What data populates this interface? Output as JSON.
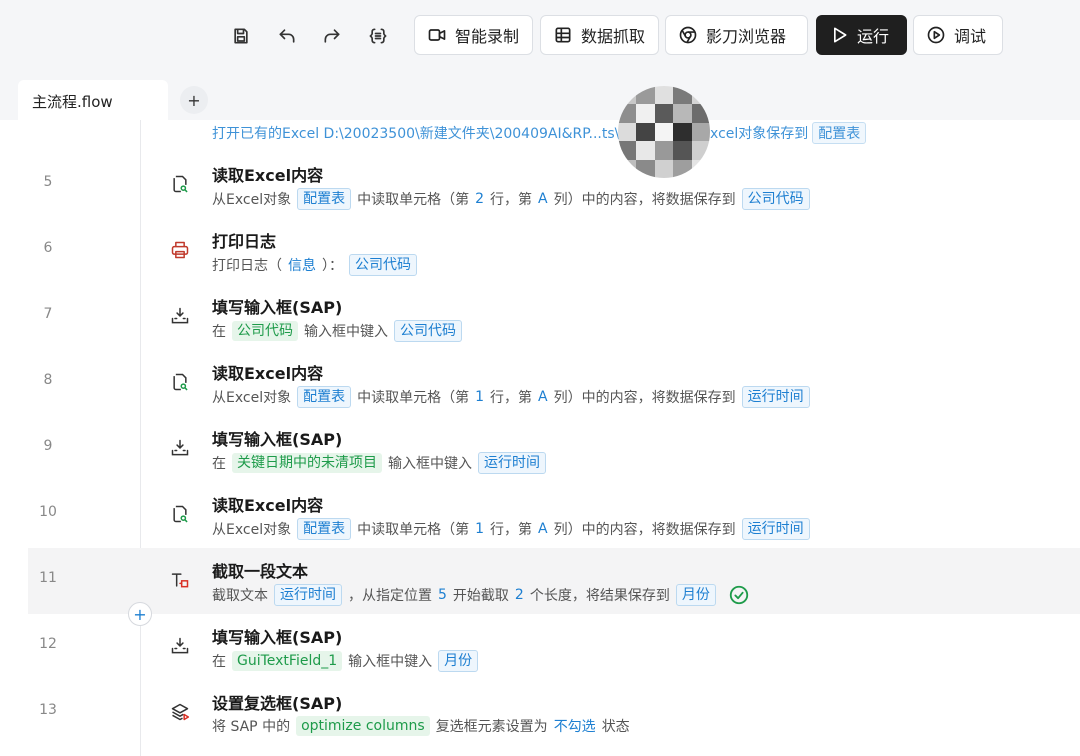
{
  "toolbar": {
    "icons": [
      "save-icon",
      "undo-icon",
      "redo-icon",
      "variables-icon"
    ],
    "buttons": {
      "record": "智能录制",
      "capture": "数据抓取",
      "browser": "影刀浏览器",
      "run": "运行",
      "debug": "调试"
    }
  },
  "tabs": {
    "main": "主流程.flow",
    "add": "+"
  },
  "partial_row": {
    "text": "打开已有的Excel  D:\\20023500\\新建文件夹\\200409AI&RP...ts\\2.BS ... ，将Excel对象保存到",
    "chip": "配置表"
  },
  "steps": [
    {
      "num": "5",
      "icon": "read-excel-icon",
      "title": "读取Excel内容",
      "desc": {
        "a": "从Excel对象",
        "b": "配置表",
        "c": "中读取单元格（第",
        "d": "2",
        "e": "行，第",
        "f": "A",
        "g": "列）中的内容，将数据保存到",
        "h": "公司代码"
      }
    },
    {
      "num": "6",
      "icon": "print-log-icon",
      "title": "打印日志",
      "desc": {
        "a": "打印日志（",
        "b": "信息",
        "c": "）：",
        "d": "公司代码"
      }
    },
    {
      "num": "7",
      "icon": "input-fill-icon",
      "title": "填写输入框(SAP)",
      "desc": {
        "a": "在",
        "b": "公司代码",
        "c": "输入框中键入",
        "d": "公司代码"
      }
    },
    {
      "num": "8",
      "icon": "read-excel-icon",
      "title": "读取Excel内容",
      "desc": {
        "a": "从Excel对象",
        "b": "配置表",
        "c": "中读取单元格（第",
        "d": "1",
        "e": "行，第",
        "f": "A",
        "g": "列）中的内容，将数据保存到",
        "h": "运行时间"
      }
    },
    {
      "num": "9",
      "icon": "input-fill-icon",
      "title": "填写输入框(SAP)",
      "desc": {
        "a": "在",
        "b": "关键日期中的未清项目",
        "c": "输入框中键入",
        "d": "运行时间"
      }
    },
    {
      "num": "10",
      "icon": "read-excel-icon",
      "title": "读取Excel内容",
      "desc": {
        "a": "从Excel对象",
        "b": "配置表",
        "c": "中读取单元格（第",
        "d": "1",
        "e": "行，第",
        "f": "A",
        "g": "列）中的内容，将数据保存到",
        "h": "运行时间"
      }
    },
    {
      "num": "11",
      "icon": "text-cut-icon",
      "title": "截取一段文本",
      "desc": {
        "a": "截取文本",
        "b": "运行时间",
        "c": "，从指定位置",
        "d": "5",
        "e": "开始截取",
        "f": "2",
        "g": "个长度，将结果保存到",
        "h": "月份"
      }
    },
    {
      "num": "12",
      "icon": "input-fill-icon",
      "title": "填写输入框(SAP)",
      "desc": {
        "a": "在",
        "b": "GuiTextField_1",
        "c": "输入框中键入",
        "d": "月份"
      }
    },
    {
      "num": "13",
      "icon": "checkbox-set-icon",
      "title": "设置复选框(SAP)",
      "desc": {
        "a": "将 SAP 中的",
        "b": "optimize columns",
        "c": "复选框元素设置为",
        "d": "不勾选",
        "e": "状态"
      }
    }
  ],
  "add_step": "+",
  "colors": {
    "accent": "#1d7fd1",
    "green": "#1e9b4a",
    "dark_button": "#1f1f1f"
  }
}
